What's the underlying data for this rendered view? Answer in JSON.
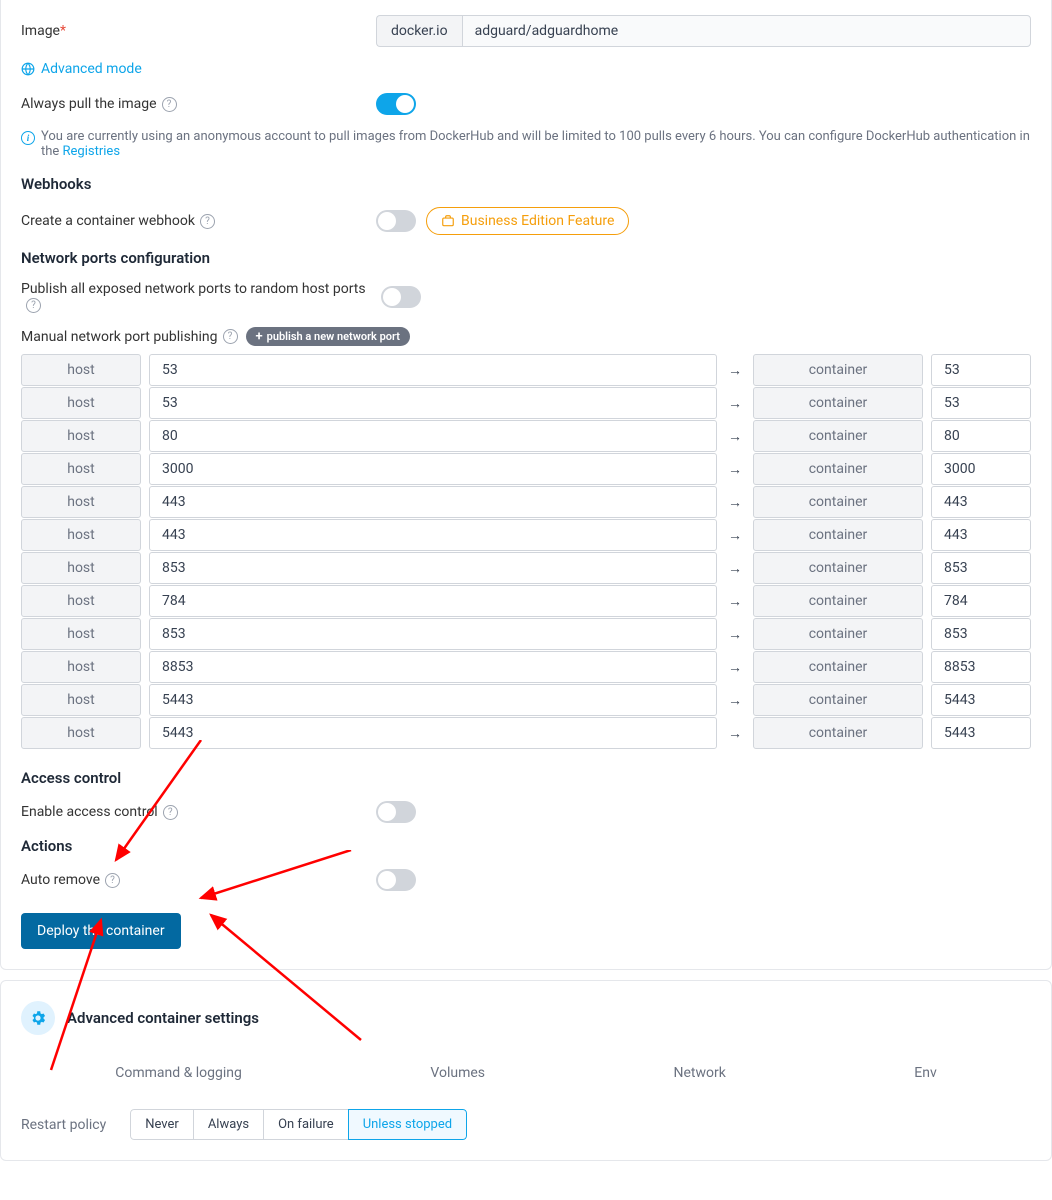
{
  "image": {
    "label": "Image",
    "registry": "docker.io",
    "name": "adguard/adguardhome"
  },
  "advancedMode": "Advanced mode",
  "alwaysPull": {
    "label": "Always pull the image",
    "on": true
  },
  "infoMsg": {
    "text": "You are currently using an anonymous account to pull images from DockerHub and will be limited to 100 pulls every 6 hours. You can configure DockerHub authentication in the ",
    "link": "Registries"
  },
  "webhooks": {
    "title": "Webhooks",
    "createLabel": "Create a container webhook",
    "tag": "Business Edition Feature"
  },
  "networkPorts": {
    "title": "Network ports configuration",
    "publishAllLabel": "Publish all exposed network ports to random host ports",
    "manualLabel": "Manual network port publishing",
    "publishBtn": "publish a new network port",
    "hostLabel": "host",
    "containerLabel": "container",
    "rows": [
      {
        "host": "53",
        "container": "53"
      },
      {
        "host": "53",
        "container": "53"
      },
      {
        "host": "80",
        "container": "80"
      },
      {
        "host": "3000",
        "container": "3000"
      },
      {
        "host": "443",
        "container": "443"
      },
      {
        "host": "443",
        "container": "443"
      },
      {
        "host": "853",
        "container": "853"
      },
      {
        "host": "784",
        "container": "784"
      },
      {
        "host": "853",
        "container": "853"
      },
      {
        "host": "8853",
        "container": "8853"
      },
      {
        "host": "5443",
        "container": "5443"
      },
      {
        "host": "5443",
        "container": "5443"
      }
    ]
  },
  "accessControl": {
    "title": "Access control",
    "enableLabel": "Enable access control"
  },
  "actions": {
    "title": "Actions",
    "autoRemoveLabel": "Auto remove",
    "deployBtn": "Deploy the container"
  },
  "advancedSettings": {
    "title": "Advanced container settings",
    "tabs": [
      "Command & logging",
      "Volumes",
      "Network",
      "Env"
    ],
    "restartLabel": "Restart policy",
    "restartOptions": [
      "Never",
      "Always",
      "On failure",
      "Unless stopped"
    ],
    "restartSelected": 3
  }
}
